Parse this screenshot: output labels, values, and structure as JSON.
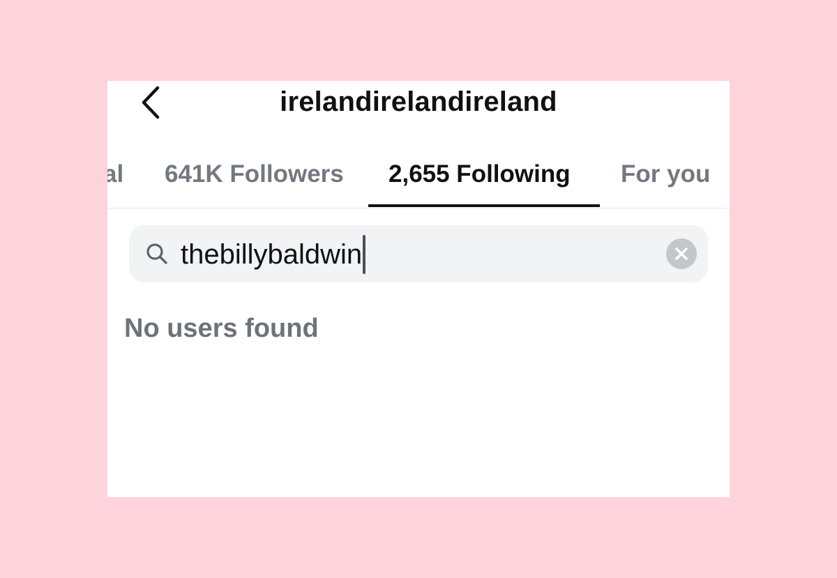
{
  "header": {
    "title": "irelandirelandireland",
    "back_icon": "chevron-left-icon"
  },
  "tabs": [
    {
      "label": "al"
    },
    {
      "label": "641K Followers"
    },
    {
      "label": "2,655 Following",
      "active": true
    },
    {
      "label": "For you"
    }
  ],
  "search": {
    "value": "thebillybaldwin",
    "icon": "search-icon",
    "clear_icon": "clear-icon"
  },
  "results": {
    "empty_message": "No users found"
  },
  "colors": {
    "background": "#FFD3DC",
    "card": "#FFFFFF",
    "active_text": "#111111",
    "inactive_text": "#737880",
    "search_bg": "#F2F3F5"
  }
}
